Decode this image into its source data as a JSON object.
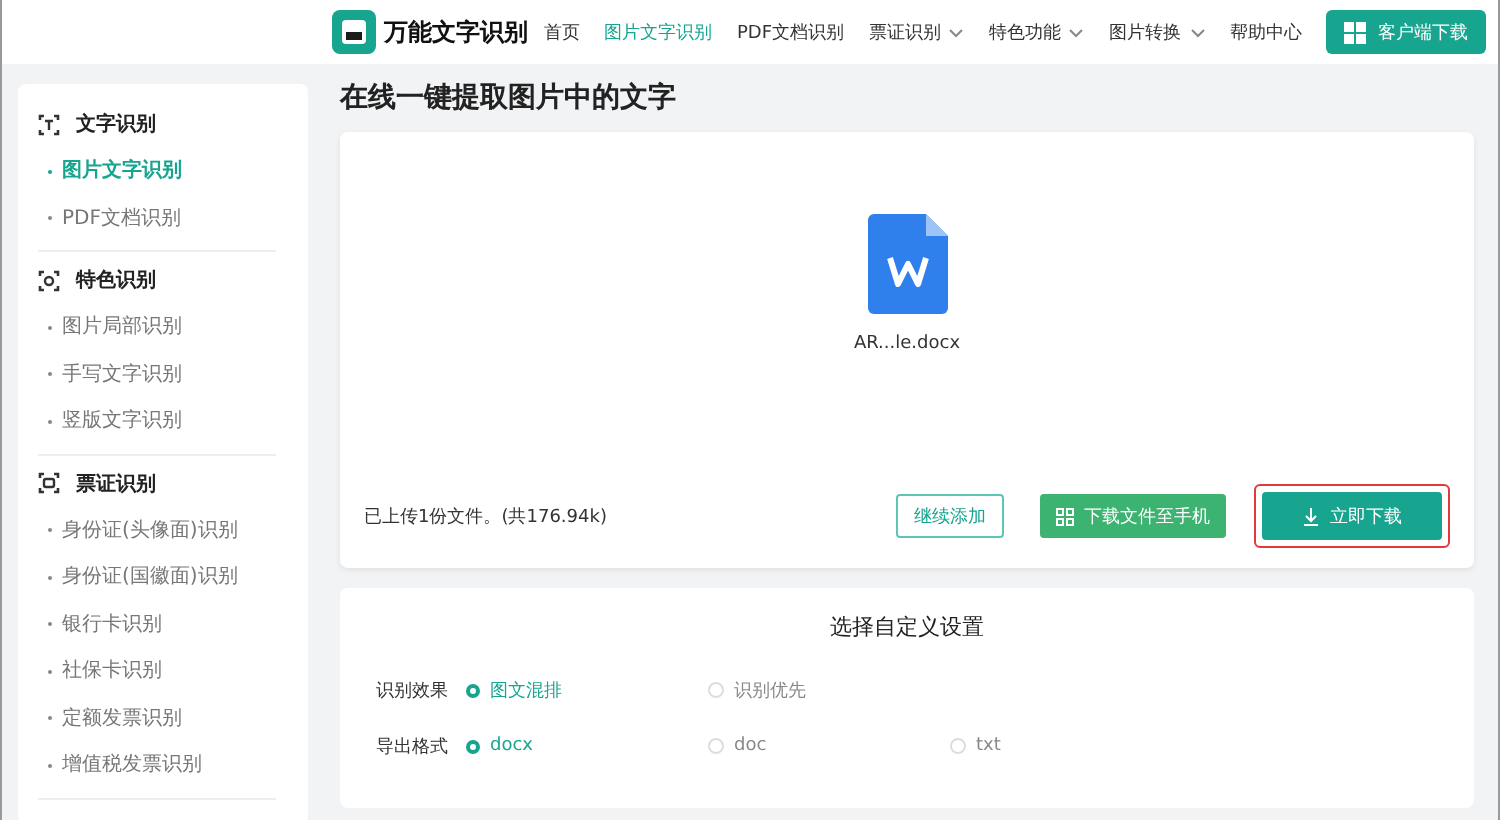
{
  "header": {
    "logo_text": "万能文字识别",
    "nav": [
      {
        "label": "首页",
        "selected": false,
        "dropdown": false
      },
      {
        "label": "图片文字识别",
        "selected": true,
        "dropdown": false
      },
      {
        "label": "PDF文档识别",
        "selected": false,
        "dropdown": false
      },
      {
        "label": "票证识别",
        "selected": false,
        "dropdown": true
      },
      {
        "label": "特色功能",
        "selected": false,
        "dropdown": true
      },
      {
        "label": "图片转换",
        "selected": false,
        "dropdown": true
      },
      {
        "label": "帮助中心",
        "selected": false,
        "dropdown": false
      }
    ],
    "download_button": "客户端下载"
  },
  "sidebar": {
    "groups": [
      {
        "title": "文字识别",
        "kind": "text",
        "items": [
          {
            "label": "图片文字识别",
            "selected": true
          },
          {
            "label": "PDF文档识别",
            "selected": false
          }
        ]
      },
      {
        "title": "特色识别",
        "kind": "feature",
        "items": [
          {
            "label": "图片局部识别",
            "selected": false
          },
          {
            "label": "手写文字识别",
            "selected": false
          },
          {
            "label": "竖版文字识别",
            "selected": false
          }
        ]
      },
      {
        "title": "票证识别",
        "kind": "ticket",
        "items": [
          {
            "label": "身份证(头像面)识别",
            "selected": false
          },
          {
            "label": "身份证(国徽面)识别",
            "selected": false
          },
          {
            "label": "银行卡识别",
            "selected": false
          },
          {
            "label": "社保卡识别",
            "selected": false
          },
          {
            "label": "定额发票识别",
            "selected": false
          },
          {
            "label": "增值税发票识别",
            "selected": false
          }
        ]
      }
    ]
  },
  "main": {
    "title": "在线一键提取图片中的文字",
    "upload": {
      "file_name": "AR...le.docx",
      "status": "已上传1份文件。(共176.94k)",
      "buttons": [
        {
          "label": "继续添加",
          "kind": "outline",
          "highlighted": false
        },
        {
          "label": "下载文件至手机",
          "kind": "phone",
          "highlighted": false
        },
        {
          "label": "立即下载",
          "kind": "download",
          "highlighted": true
        }
      ]
    },
    "settings": {
      "title": "选择自定义设置",
      "rows": [
        {
          "label": "识别效果",
          "options": [
            {
              "label": "图文混排",
              "selected": true
            },
            {
              "label": "识别优先",
              "selected": false
            }
          ]
        },
        {
          "label": "导出格式",
          "options": [
            {
              "label": "docx",
              "selected": true
            },
            {
              "label": "doc",
              "selected": false
            },
            {
              "label": "txt",
              "selected": false
            }
          ]
        }
      ]
    }
  }
}
